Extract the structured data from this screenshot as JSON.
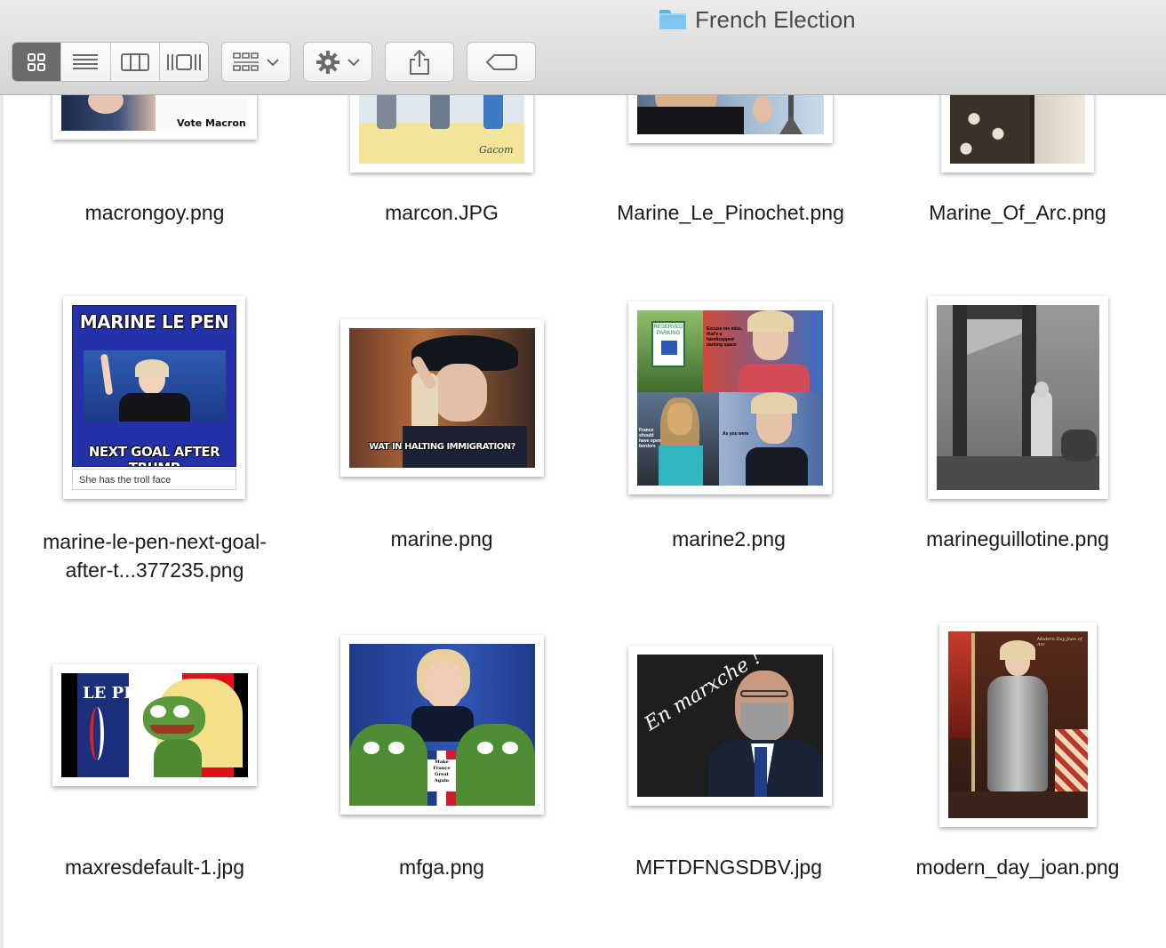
{
  "window": {
    "title": "French Election",
    "folder_icon": "folder-icon"
  },
  "toolbar": {
    "view_modes": [
      {
        "name": "icon-view",
        "icon": "grid-icon",
        "active": true
      },
      {
        "name": "list-view",
        "icon": "list-icon",
        "active": false
      },
      {
        "name": "column-view",
        "icon": "columns-icon",
        "active": false
      },
      {
        "name": "coverflow-view",
        "icon": "coverflow-icon",
        "active": false
      }
    ],
    "arrange_icon": "arrange-grid-icon",
    "action_icon": "gear-icon",
    "share_icon": "share-icon",
    "tags_icon": "tag-icon"
  },
  "files": [
    {
      "name": "macrongoy.png",
      "thumb_text": "Vote Macron"
    },
    {
      "name": "marcon.JPG",
      "thumb_text": "Gacom"
    },
    {
      "name": "Marine_Le_Pinochet.png"
    },
    {
      "name": "Marine_Of_Arc.png"
    },
    {
      "name": "marine-le-pen-next-goal-after-t...377235.png",
      "thumb_top": "MARINE LE PEN",
      "thumb_bottom": "NEXT GOAL AFTER TRUMP",
      "thumb_caption": "She has the troll face"
    },
    {
      "name": "marine.png",
      "thumb_text": "WAT IN HALTING IMMIGRATION?"
    },
    {
      "name": "marine2.png",
      "thumb_sign": "RESERVED PARKING",
      "thumb_text1": "Excuse me miss, that's a handicapped parking space",
      "thumb_text2": "France should have open borders",
      "thumb_text3": "As you were"
    },
    {
      "name": "marineguillotine.png"
    },
    {
      "name": "maxresdefault-1.jpg",
      "thumb_text": "LE PEN"
    },
    {
      "name": "mfga.png",
      "thumb_text": "Make France Great Again"
    },
    {
      "name": "MFTDFNGSDBV.jpg",
      "thumb_text": "En marxche !"
    },
    {
      "name": "modern_day_joan.png",
      "thumb_text": "Modern Day Joan of Arc"
    }
  ]
}
